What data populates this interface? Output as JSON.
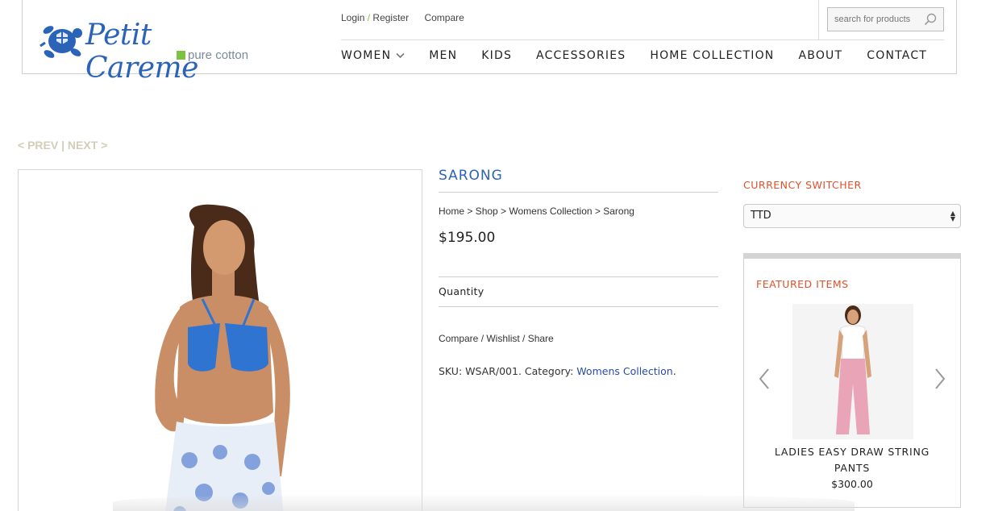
{
  "brand": {
    "name": "Petit Careme",
    "tagline": "pure cotton",
    "color": "#2a63b8",
    "accent": "#7dc242"
  },
  "toplinks": {
    "login": "Login",
    "separator": "/",
    "register": "Register",
    "compare": "Compare"
  },
  "search": {
    "placeholder": "search for products",
    "icon": "search-icon"
  },
  "nav": {
    "items": [
      "WOMEN",
      "MEN",
      "KIDS",
      "ACCESSORIES",
      "HOME COLLECTION",
      "ABOUT",
      "CONTACT"
    ]
  },
  "pager": {
    "prev": "< PREV",
    "divider": " | ",
    "next": "NEXT >"
  },
  "product": {
    "title": "SARONG",
    "breadcrumb": "Home > Shop > Womens Collection > Sarong",
    "price": "$195.00",
    "quantity_label": "Quantity",
    "actions": "Compare / Wishlist / Share",
    "sku_text": "SKU: WSAR/001. Category: ",
    "category": "Womens Collection",
    "category_suffix": "."
  },
  "sidebar": {
    "currency_title": "CURRENCY SWITCHER",
    "currency_value": "TTD",
    "featured_title": "FEATURED ITEMS",
    "featured_item": {
      "name": "LADIES EASY DRAW STRING PANTS",
      "price": "$300.00"
    }
  },
  "colors": {
    "title_blue": "#2a63b8",
    "widget_orange": "#e0502a",
    "pager_beige": "#d3cdb6"
  }
}
